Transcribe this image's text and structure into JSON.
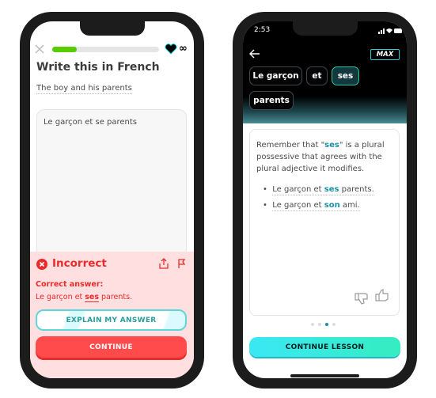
{
  "left": {
    "progress": 0.23,
    "lives": "∞",
    "title": "Write this in French",
    "prompt": "The boy and his parents",
    "answer_input": "Le garçon et se parents",
    "feedback": {
      "status": "Incorrect",
      "correct_label": "Correct answer:",
      "correct_pre": "Le garçon et ",
      "correct_word": "ses",
      "correct_post": " parents.",
      "explain_button": "EXPLAIN MY ANSWER",
      "continue_button": "CONTINUE"
    },
    "colors": {
      "error": "#ea2b2b",
      "panel": "#ffdfe0",
      "progress": "#58cc02",
      "button": "#ff4b4b"
    }
  },
  "right": {
    "time": "2:53",
    "badge": "MAX",
    "chips": [
      "Le garçon",
      "et",
      "ses",
      "parents"
    ],
    "selected_chip": "ses",
    "explanation": {
      "p1": "Remember that \"",
      "p1_word": "ses",
      "p1_rest": "\" is a plural",
      "line2": "possessive that agrees with the",
      "line3": "plural adjective it modifies.",
      "bullets": [
        {
          "pre": "Le garçon et ",
          "word": "ses",
          "post": " parents."
        },
        {
          "pre": "Le garçon et ",
          "word": "son",
          "post": " ami."
        }
      ]
    },
    "pager": {
      "total": 4,
      "active": 3
    },
    "continue_button": "CONTINUE LESSON",
    "colors": {
      "accent": "#1a8fa3",
      "button_start": "#3ae8f5",
      "button_end": "#34edc0"
    }
  }
}
